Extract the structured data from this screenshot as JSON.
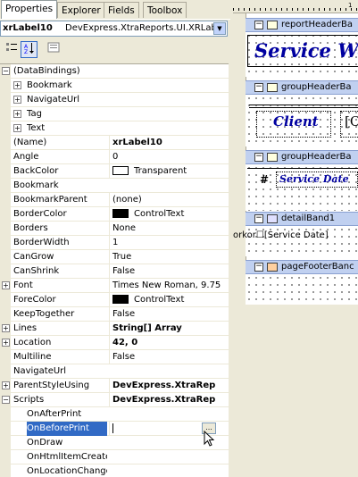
{
  "tabs": [
    "Properties",
    "Explorer",
    "Fields",
    "Toolbox"
  ],
  "object": {
    "name": "xrLabel10",
    "type": "DevExpress.XtraReports.UI.XRLab"
  },
  "toolbar": [
    "categorized-icon",
    "alphabetical-icon",
    "property-pages-icon"
  ],
  "properties": [
    {
      "name": "(DataBindings)",
      "value": "",
      "expander": "minus",
      "level": 0
    },
    {
      "name": "Bookmark",
      "value": "",
      "expander": "plus",
      "level": 1
    },
    {
      "name": "NavigateUrl",
      "value": "",
      "expander": "plus",
      "level": 1
    },
    {
      "name": "Tag",
      "value": "",
      "expander": "plus",
      "level": 1
    },
    {
      "name": "Text",
      "value": "",
      "expander": "plus",
      "level": 1
    },
    {
      "name": "(Name)",
      "value": "xrLabel10",
      "bold": true,
      "level": 0
    },
    {
      "name": "Angle",
      "value": "0",
      "level": 0
    },
    {
      "name": "BackColor",
      "value": "Transparent",
      "swatch": "#ffffff",
      "level": 0
    },
    {
      "name": "Bookmark",
      "value": "",
      "level": 0
    },
    {
      "name": "BookmarkParent",
      "value": "(none)",
      "level": 0
    },
    {
      "name": "BorderColor",
      "value": "ControlText",
      "swatch": "#000000",
      "level": 0
    },
    {
      "name": "Borders",
      "value": "None",
      "level": 0
    },
    {
      "name": "BorderWidth",
      "value": "1",
      "level": 0
    },
    {
      "name": "CanGrow",
      "value": "True",
      "level": 0
    },
    {
      "name": "CanShrink",
      "value": "False",
      "level": 0
    },
    {
      "name": "Font",
      "value": "Times New Roman, 9.75",
      "expander": "plus",
      "level": 0
    },
    {
      "name": "ForeColor",
      "value": "ControlText",
      "swatch": "#000000",
      "level": 0
    },
    {
      "name": "KeepTogether",
      "value": "False",
      "level": 0
    },
    {
      "name": "Lines",
      "value": "String[] Array",
      "bold": true,
      "expander": "plus",
      "level": 0
    },
    {
      "name": "Location",
      "value": "42, 0",
      "bold": true,
      "expander": "plus",
      "level": 0
    },
    {
      "name": "Multiline",
      "value": "False",
      "level": 0
    },
    {
      "name": "NavigateUrl",
      "value": "",
      "level": 0
    },
    {
      "name": "ParentStyleUsing",
      "value": "DevExpress.XtraRep",
      "bold": true,
      "expander": "plus",
      "level": 0
    },
    {
      "name": "Scripts",
      "value": "DevExpress.XtraRep",
      "bold": true,
      "expander": "minus",
      "level": 0
    },
    {
      "name": "OnAfterPrint",
      "value": "",
      "level": 1
    },
    {
      "name": "OnBeforePrint",
      "value": "",
      "level": 1,
      "selected": true,
      "ellipsis": "..."
    },
    {
      "name": "OnDraw",
      "value": "",
      "level": 1
    },
    {
      "name": "OnHtmlItemCreated",
      "value": "",
      "level": 1
    },
    {
      "name": "OnLocationChange",
      "value": "",
      "level": 1
    }
  ],
  "designer": {
    "ruler_label": "1",
    "bands": [
      {
        "label": "reportHeaderBa"
      },
      {
        "label": "groupHeaderBa"
      },
      {
        "label": "groupHeaderBa"
      },
      {
        "label": "detailBand1"
      },
      {
        "label": "pageFooterBanc"
      }
    ],
    "title_text": "Service Wo",
    "client_label": "Client",
    "client_field": "[C",
    "hash": "#",
    "service_date": "Service Date",
    "detail_text": "orkor☐[Service Date]"
  }
}
